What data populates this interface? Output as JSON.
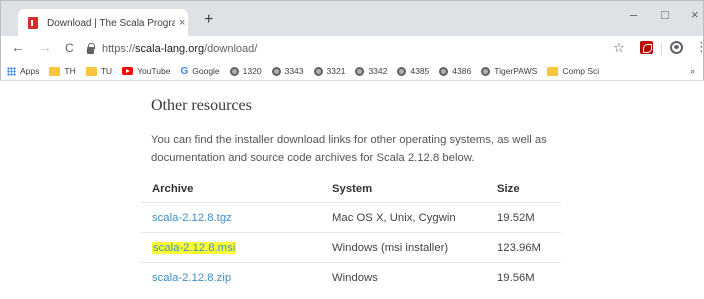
{
  "browser": {
    "tab": {
      "title": "Download | The Scala Programm",
      "close": "×"
    },
    "new_tab": "+",
    "window_controls": {
      "minimize": "–",
      "maximize": "□",
      "close": "×"
    },
    "nav": {
      "back": "←",
      "forward": "→",
      "reload": "C"
    },
    "url": {
      "scheme": "https://",
      "host": "scala-lang.org",
      "path": "/download/"
    },
    "star": "☆",
    "menu": "⋮",
    "bookmarks": [
      {
        "label": "Apps",
        "icon": "apps-icon"
      },
      {
        "label": "TH",
        "icon": "folder-icon"
      },
      {
        "label": "TU",
        "icon": "folder-icon"
      },
      {
        "label": "YouTube",
        "icon": "youtube-icon"
      },
      {
        "label": "Google",
        "icon": "google-icon"
      },
      {
        "label": "1320",
        "icon": "globe-icon"
      },
      {
        "label": "3343",
        "icon": "globe-icon"
      },
      {
        "label": "3321",
        "icon": "globe-icon"
      },
      {
        "label": "3342",
        "icon": "globe-icon"
      },
      {
        "label": "4385",
        "icon": "globe-icon"
      },
      {
        "label": "4386",
        "icon": "globe-icon"
      },
      {
        "label": "TigerPAWS",
        "icon": "globe-icon"
      },
      {
        "label": "Comp Sci",
        "icon": "folder-icon"
      }
    ],
    "bookmarks_overflow": "»"
  },
  "page": {
    "heading": "Other resources",
    "paragraph": "You can find the installer download links for other operating systems, as well as documentation and source code archives for Scala 2.12.8 below.",
    "table": {
      "headers": [
        "Archive",
        "System",
        "Size"
      ],
      "rows": [
        {
          "archive": "scala-2.12.8.tgz",
          "system": "Mac OS X, Unix, Cygwin",
          "size": "19.52M"
        },
        {
          "archive": "scala-2.12.8.msi",
          "system": "Windows (msi installer)",
          "size": "123.96M"
        },
        {
          "archive": "scala-2.12.8.zip",
          "system": "Windows",
          "size": "19.56M"
        }
      ]
    },
    "highlight_color": "#ffff33",
    "link_color": "#3d8fc7"
  }
}
